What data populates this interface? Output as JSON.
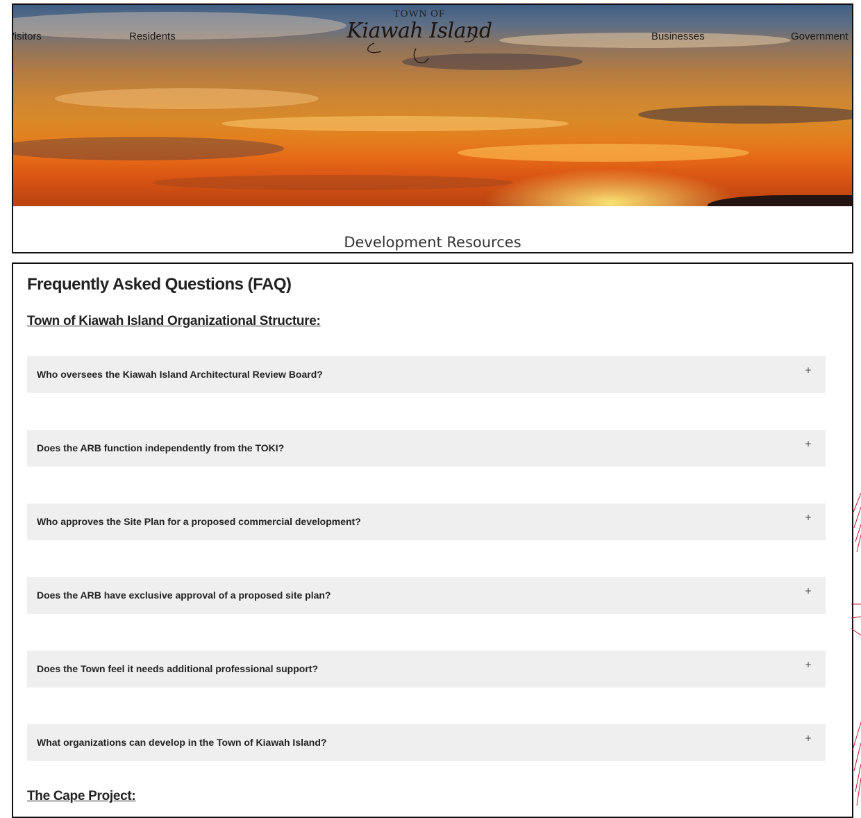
{
  "header": {
    "nav_left": [
      {
        "label": "Visitors"
      },
      {
        "label": "Residents"
      }
    ],
    "nav_right": [
      {
        "label": "Businesses"
      },
      {
        "label": "Government"
      }
    ],
    "logo": {
      "top": "TOWN OF",
      "script": "Kiawah Island"
    },
    "page_title": "Development Resources",
    "colors": {
      "sky_top": "#3f5f86",
      "sunset": "#e3801f",
      "horizon": "#b9420f"
    }
  },
  "content": {
    "faq_heading": "Frequently Asked Questions (FAQ)",
    "sections": [
      {
        "title": "Town of Kiawah Island Organizational Structure:",
        "items": [
          {
            "question": "Who oversees the Kiawah Island Architectural Review Board?",
            "toggle": "+"
          },
          {
            "question": "Does the ARB function independently from the TOKI?",
            "toggle": "+"
          },
          {
            "question": "Who approves the Site Plan for a proposed commercial development?",
            "toggle": "+"
          },
          {
            "question": "Does the ARB have exclusive approval of a proposed site plan?",
            "toggle": "+"
          },
          {
            "question": "Does the Town feel it needs additional professional support?",
            "toggle": "+"
          },
          {
            "question": "What organizations can develop in the Town of Kiawah Island?",
            "toggle": "+"
          }
        ]
      },
      {
        "title": "The Cape Project:"
      }
    ]
  }
}
